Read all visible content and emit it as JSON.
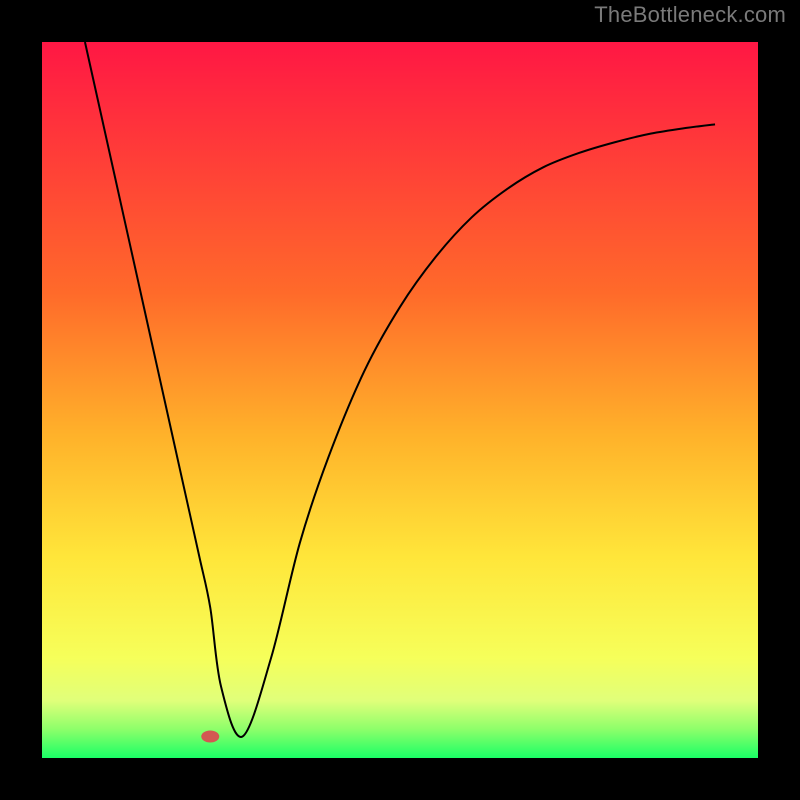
{
  "watermark": "TheBottleneck.com",
  "chart_data": {
    "type": "line",
    "title": "",
    "xlabel": "",
    "ylabel": "",
    "xlim": [
      0,
      100
    ],
    "ylim": [
      0,
      100
    ],
    "series": [
      {
        "name": "bottleneck-curve",
        "x": [
          6,
          10,
          14,
          18,
          20,
          22,
          23.5,
          25,
          28,
          32,
          36,
          40,
          45,
          50,
          55,
          60,
          65,
          70,
          75,
          80,
          85,
          90,
          94
        ],
        "values": [
          100,
          82,
          64,
          46,
          37,
          28,
          21,
          10,
          3,
          14,
          30,
          42,
          54,
          63,
          70,
          75.5,
          79.5,
          82.5,
          84.5,
          86,
          87.2,
          88,
          88.5
        ]
      }
    ],
    "marker": {
      "x": 23.5,
      "y": 3,
      "color": "#d35852"
    },
    "gradient_stops": [
      {
        "offset": 0,
        "color": "#ff1744"
      },
      {
        "offset": 35,
        "color": "#ff6a2a"
      },
      {
        "offset": 55,
        "color": "#ffb22a"
      },
      {
        "offset": 72,
        "color": "#ffe63a"
      },
      {
        "offset": 86,
        "color": "#f6ff5a"
      },
      {
        "offset": 92,
        "color": "#e0ff7a"
      },
      {
        "offset": 96,
        "color": "#8dff6a"
      },
      {
        "offset": 100,
        "color": "#1aff66"
      }
    ],
    "frame": {
      "outer_margin": 0,
      "inner_margin": 42,
      "inner_size": 716,
      "border_color": "#000000"
    }
  }
}
